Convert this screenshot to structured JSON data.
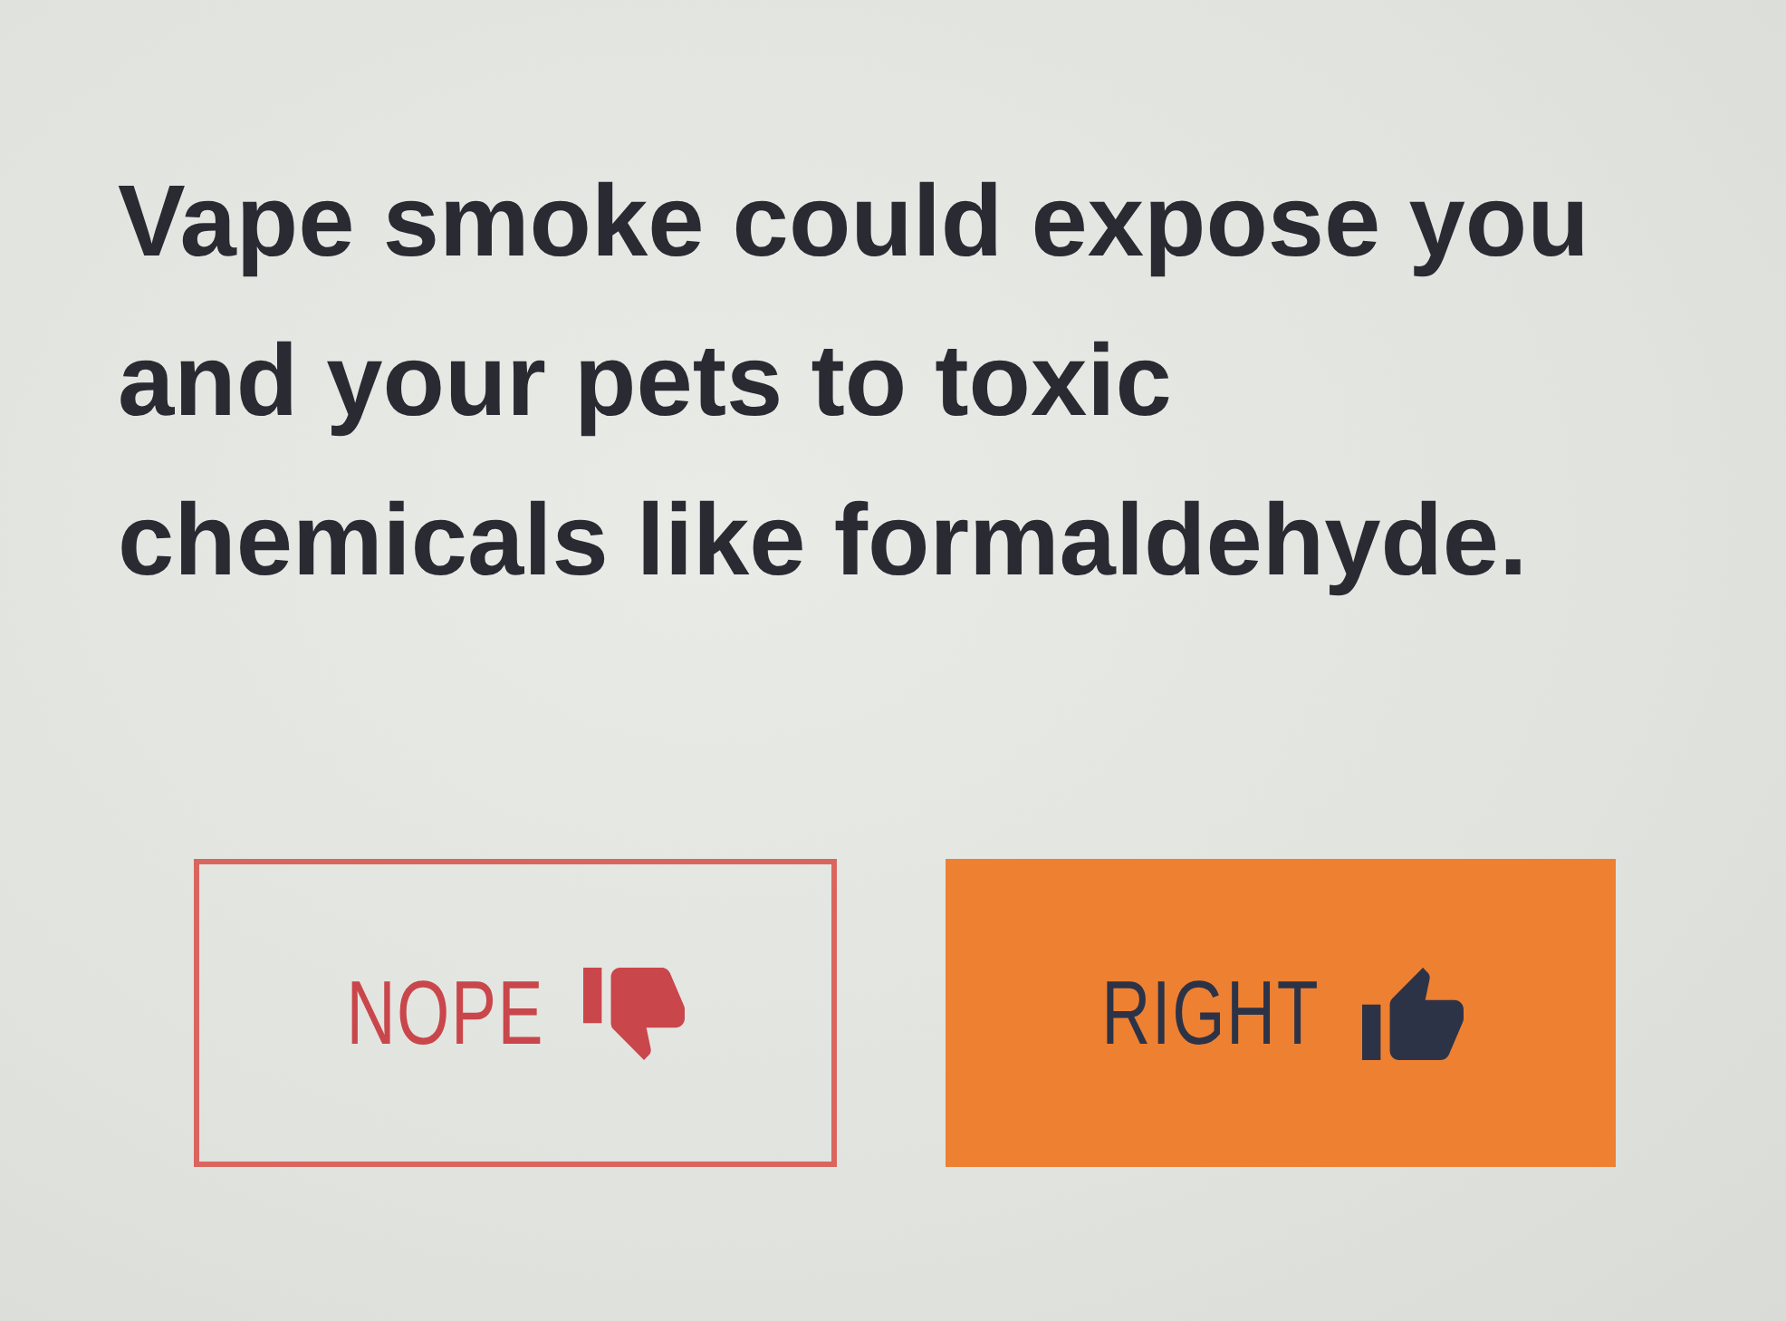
{
  "question": "Vape smoke could expose you and your pets to toxic chemicals like formaldehyde.",
  "buttons": [
    {
      "label": "NOPE",
      "kind": "reject",
      "selected": false
    },
    {
      "label": "RIGHT",
      "kind": "accept",
      "selected": true
    }
  ]
}
